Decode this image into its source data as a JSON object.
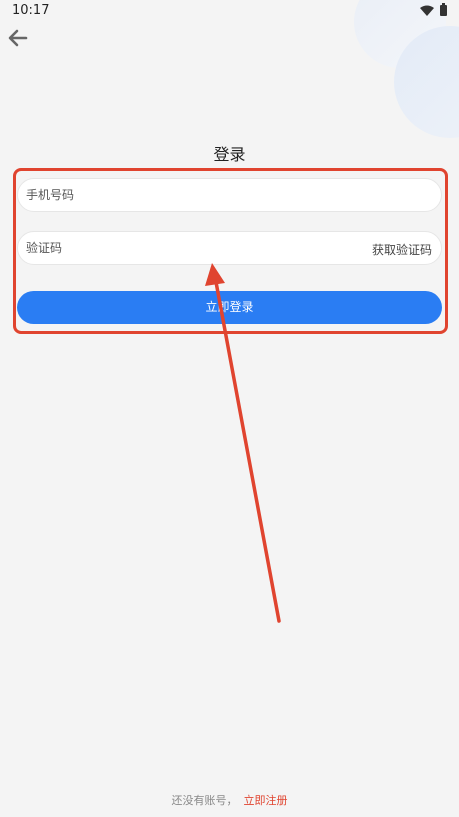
{
  "status_bar": {
    "time": "10:17",
    "wifi_icon": "wifi-icon",
    "battery_icon": "battery-icon"
  },
  "header": {
    "back_icon": "arrow-left-icon",
    "title": "登录"
  },
  "form": {
    "phone": {
      "placeholder": "手机号码",
      "value": ""
    },
    "code": {
      "placeholder": "验证码",
      "value": ""
    },
    "get_code_label": "获取验证码",
    "login_label": "立即登录"
  },
  "footer": {
    "no_account_text": "还没有账号，",
    "register_label": "立即注册"
  },
  "colors": {
    "background": "#f4f4f4",
    "primary": "#2a7df3",
    "annotation": "#e0442f",
    "register_link": "#e0442f"
  }
}
